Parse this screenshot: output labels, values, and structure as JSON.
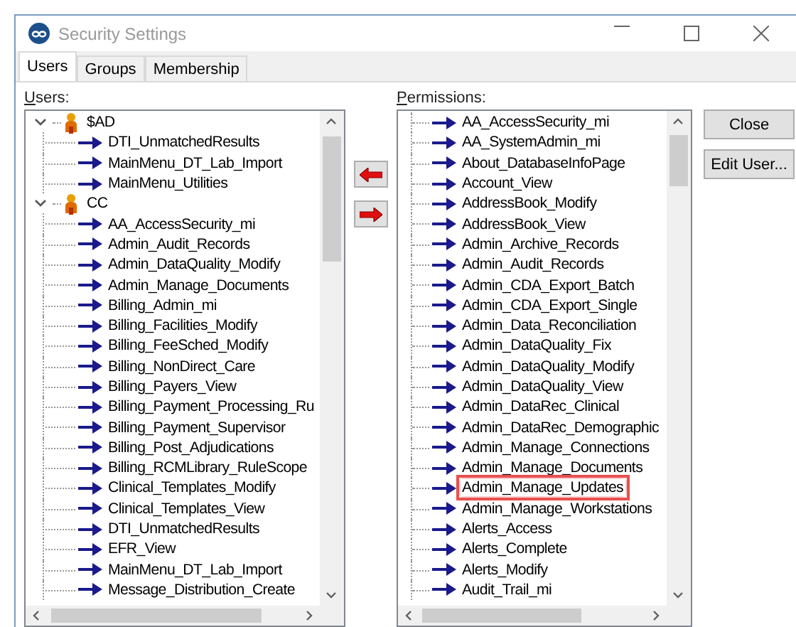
{
  "window": {
    "title": "Security Settings"
  },
  "tabs": [
    {
      "label": "Users",
      "selected": true
    },
    {
      "label": "Groups",
      "selected": false
    },
    {
      "label": "Membership",
      "selected": false
    }
  ],
  "users": {
    "label": "Users:",
    "tree": [
      {
        "name": "$AD",
        "expanded": true,
        "children": [
          "DTI_UnmatchedResults",
          "MainMenu_DT_Lab_Import",
          "MainMenu_Utilities"
        ]
      },
      {
        "name": "CC",
        "expanded": true,
        "children": [
          "AA_AccessSecurity_mi",
          "Admin_Audit_Records",
          "Admin_DataQuality_Modify",
          "Admin_Manage_Documents",
          "Billing_Admin_mi",
          "Billing_Facilities_Modify",
          "Billing_FeeSched_Modify",
          "Billing_NonDirect_Care",
          "Billing_Payers_View",
          "Billing_Payment_Processing_Ru",
          "Billing_Payment_Supervisor",
          "Billing_Post_Adjudications",
          "Billing_RCMLibrary_RuleScope",
          "Clinical_Templates_Modify",
          "Clinical_Templates_View",
          "DTI_UnmatchedResults",
          "EFR_View",
          "MainMenu_DT_Lab_Import",
          "Message_Distribution_Create"
        ]
      }
    ]
  },
  "transfer_buttons": [
    {
      "kind": "add"
    },
    {
      "kind": "remove"
    }
  ],
  "permissions": {
    "label": "Permissions:",
    "items": [
      {
        "name": "AA_AccessSecurity_mi",
        "highlighted": false
      },
      {
        "name": "AA_SystemAdmin_mi",
        "highlighted": false
      },
      {
        "name": "About_DatabaseInfoPage",
        "highlighted": false
      },
      {
        "name": "Account_View",
        "highlighted": false
      },
      {
        "name": "AddressBook_Modify",
        "highlighted": false
      },
      {
        "name": "AddressBook_View",
        "highlighted": false
      },
      {
        "name": "Admin_Archive_Records",
        "highlighted": false
      },
      {
        "name": "Admin_Audit_Records",
        "highlighted": false
      },
      {
        "name": "Admin_CDA_Export_Batch",
        "highlighted": false
      },
      {
        "name": "Admin_CDA_Export_Single",
        "highlighted": false
      },
      {
        "name": "Admin_Data_Reconciliation",
        "highlighted": false
      },
      {
        "name": "Admin_DataQuality_Fix",
        "highlighted": false
      },
      {
        "name": "Admin_DataQuality_Modify",
        "highlighted": false
      },
      {
        "name": "Admin_DataQuality_View",
        "highlighted": false
      },
      {
        "name": "Admin_DataRec_Clinical",
        "highlighted": false
      },
      {
        "name": "Admin_DataRec_Demographic",
        "highlighted": false
      },
      {
        "name": "Admin_Manage_Connections",
        "highlighted": false
      },
      {
        "name": "Admin_Manage_Documents",
        "highlighted": false
      },
      {
        "name": "Admin_Manage_Updates",
        "highlighted": true
      },
      {
        "name": "Admin_Manage_Workstations",
        "highlighted": false
      },
      {
        "name": "Alerts_Access",
        "highlighted": false
      },
      {
        "name": "Alerts_Complete",
        "highlighted": false
      },
      {
        "name": "Alerts_Modify",
        "highlighted": false
      },
      {
        "name": "Audit_Trail_mi",
        "highlighted": false
      }
    ]
  },
  "buttons": [
    "Close",
    "Edit User..."
  ]
}
